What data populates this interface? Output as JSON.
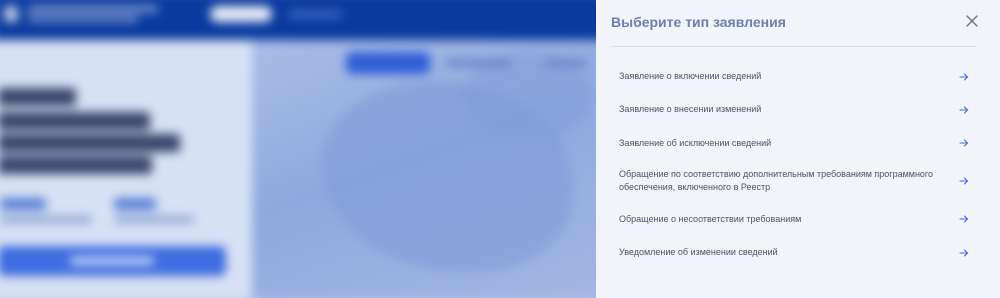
{
  "dialog": {
    "title": "Выберите тип заявления",
    "options": [
      {
        "label": "Заявление о включении сведений"
      },
      {
        "label": "Заявление о внесении изменений"
      },
      {
        "label": "Заявление об исключении сведений"
      },
      {
        "label": "Обращение по соответствию дополнительным требованиям программного обеспечения, включенного в Реестр"
      },
      {
        "label": "Обращение о несоответствии требованиям"
      },
      {
        "label": "Уведомление об изменении сведений"
      }
    ]
  },
  "colors": {
    "title": "#6c7fb3",
    "arrow": "#3d6be0",
    "drawer_bg": "#f2f4fa",
    "header_bg": "#0a3a9e"
  },
  "icons": {
    "close": "close-icon",
    "option": "arrow-right-icon"
  }
}
